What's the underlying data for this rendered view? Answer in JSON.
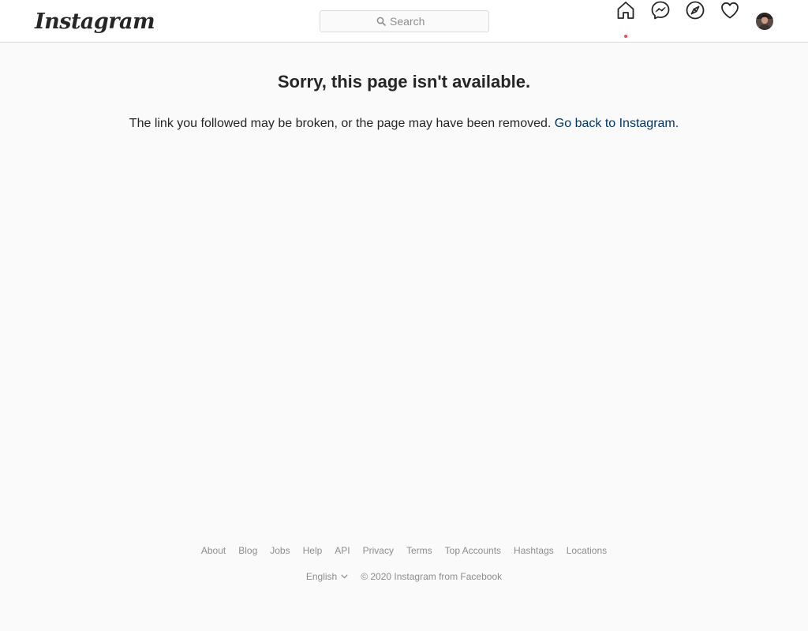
{
  "header": {
    "logo_text": "Instagram",
    "search_placeholder": "Search",
    "icons": [
      "home-icon",
      "messenger-icon",
      "explore-icon",
      "activity-heart-icon",
      "profile-avatar"
    ]
  },
  "error": {
    "title": "Sorry, this page isn't available.",
    "message": "The link you followed may be broken, or the page may have been removed.",
    "link_text": "Go back to Instagram."
  },
  "footer": {
    "links": [
      "About",
      "Blog",
      "Jobs",
      "Help",
      "API",
      "Privacy",
      "Terms",
      "Top Accounts",
      "Hashtags",
      "Locations"
    ],
    "language": "English",
    "copyright": "© 2020 Instagram from Facebook"
  },
  "colors": {
    "background": "#fafafa",
    "text": "#262626",
    "link": "#00376b",
    "muted": "#8e8e8e",
    "border": "#dbdbdb",
    "notification_dot": "#ed4956"
  }
}
